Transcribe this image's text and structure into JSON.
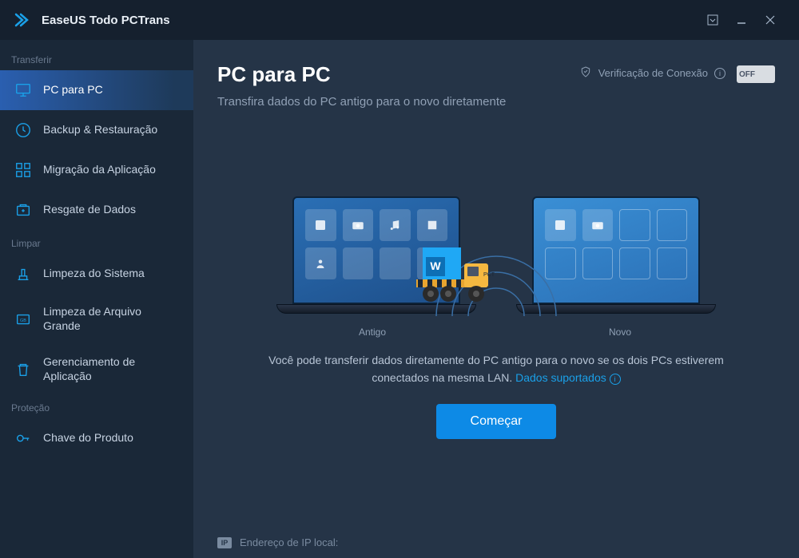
{
  "titlebar": {
    "app_name": "EaseUS Todo PCTrans"
  },
  "sidebar": {
    "sections": {
      "transfer_label": "Transferir",
      "clean_label": "Limpar",
      "protect_label": "Proteção"
    },
    "items": [
      {
        "label": "PC para PC"
      },
      {
        "label": "Backup & Restauração"
      },
      {
        "label": "Migração da Aplicação"
      },
      {
        "label": "Resgate de Dados"
      },
      {
        "label": "Limpeza do Sistema"
      },
      {
        "label": "Limpeza de Arquivo Grande"
      },
      {
        "label": "Gerenciamento de Aplicação"
      },
      {
        "label": "Chave do Produto"
      }
    ]
  },
  "main": {
    "title": "PC para PC",
    "subtitle": "Transfira dados do PC antigo para o novo diretamente",
    "verify_label": "Verificação de Conexão",
    "toggle_state": "OFF",
    "old_label": "Antigo",
    "new_label": "Novo",
    "truck_label": "PCT",
    "desc_1": "Você pode transferir dados diretamente do PC antigo para o novo se os dois PCs estiverem conectados na mesma LAN. ",
    "desc_link": "Dados suportados",
    "start_label": "Começar",
    "ip_badge": "IP",
    "ip_label": "Endereço de IP local:"
  }
}
